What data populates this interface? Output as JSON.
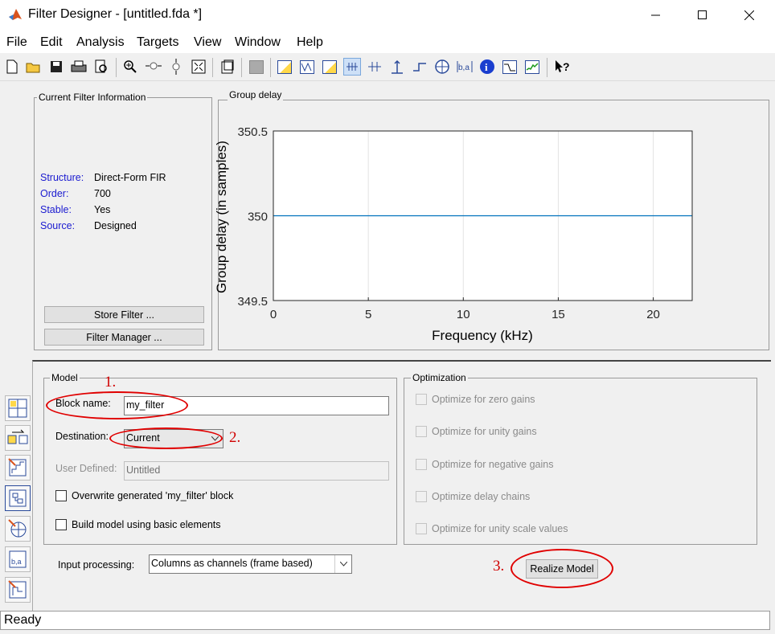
{
  "window": {
    "title": "Filter Designer -  [untitled.fda *]"
  },
  "menu": [
    "File",
    "Edit",
    "Analysis",
    "Targets",
    "View",
    "Window",
    "Help"
  ],
  "toolbar_icons": [
    "new-icon",
    "open-icon",
    "save-icon",
    "print-icon",
    "print-preview-icon",
    "zoom-in-icon",
    "zoom-x-icon",
    "zoom-y-icon",
    "full-view-icon",
    "new-figure-icon",
    "filter-type-icon",
    "magnitude-response-icon",
    "phase-response-icon",
    "mag-phase-icon",
    "group-delay-icon",
    "phase-delay-icon",
    "impulse-response-icon",
    "step-response-icon",
    "pole-zero-icon",
    "filter-coefficients-icon",
    "filter-info-icon",
    "magnitude-estimate-icon",
    "round-off-noise-icon",
    "whats-this-icon"
  ],
  "current_filter": {
    "title": "Current Filter Information",
    "rows": [
      {
        "label": "Structure:",
        "value": "Direct-Form FIR"
      },
      {
        "label": "Order:",
        "value": "700"
      },
      {
        "label": "Stable:",
        "value": "Yes"
      },
      {
        "label": "Source:",
        "value": "Designed"
      }
    ],
    "store_button": "Store Filter ...",
    "manager_button": "Filter Manager ..."
  },
  "plot_panel": {
    "title": "Group delay"
  },
  "chart_data": {
    "type": "line",
    "title": "",
    "xlabel": "Frequency (kHz)",
    "ylabel": "Group delay (in samples)",
    "xlim": [
      0,
      22.05
    ],
    "ylim": [
      349.5,
      350.5
    ],
    "xticks": [
      0,
      5,
      10,
      15,
      20
    ],
    "yticks": [
      349.5,
      350,
      350.5
    ],
    "ytick_labels": [
      "349.5",
      "350",
      "350.5"
    ],
    "grid": "vertical",
    "line_color": "#0072bd",
    "series": [
      {
        "x": [
          0,
          22.05
        ],
        "y": [
          350,
          350
        ]
      }
    ]
  },
  "model": {
    "title": "Model",
    "block_name_label": "Block name:",
    "block_name_value": "my_filter",
    "destination_label": "Destination:",
    "destination_value": "Current",
    "user_defined_label": "User Defined:",
    "user_defined_value": "Untitled",
    "overwrite_label": "Overwrite generated 'my_filter' block",
    "basic_elements_label": "Build model using basic elements"
  },
  "optimization": {
    "title": "Optimization",
    "options": [
      "Optimize for zero gains",
      "Optimize for unity gains",
      "Optimize for negative gains",
      "Optimize delay chains",
      "Optimize for unity scale values"
    ]
  },
  "input_processing": {
    "label": "Input processing:",
    "value": "Columns as channels (frame based)"
  },
  "realize_button": "Realize Model",
  "annotations": [
    "1.",
    "2.",
    "3."
  ],
  "status": "Ready"
}
